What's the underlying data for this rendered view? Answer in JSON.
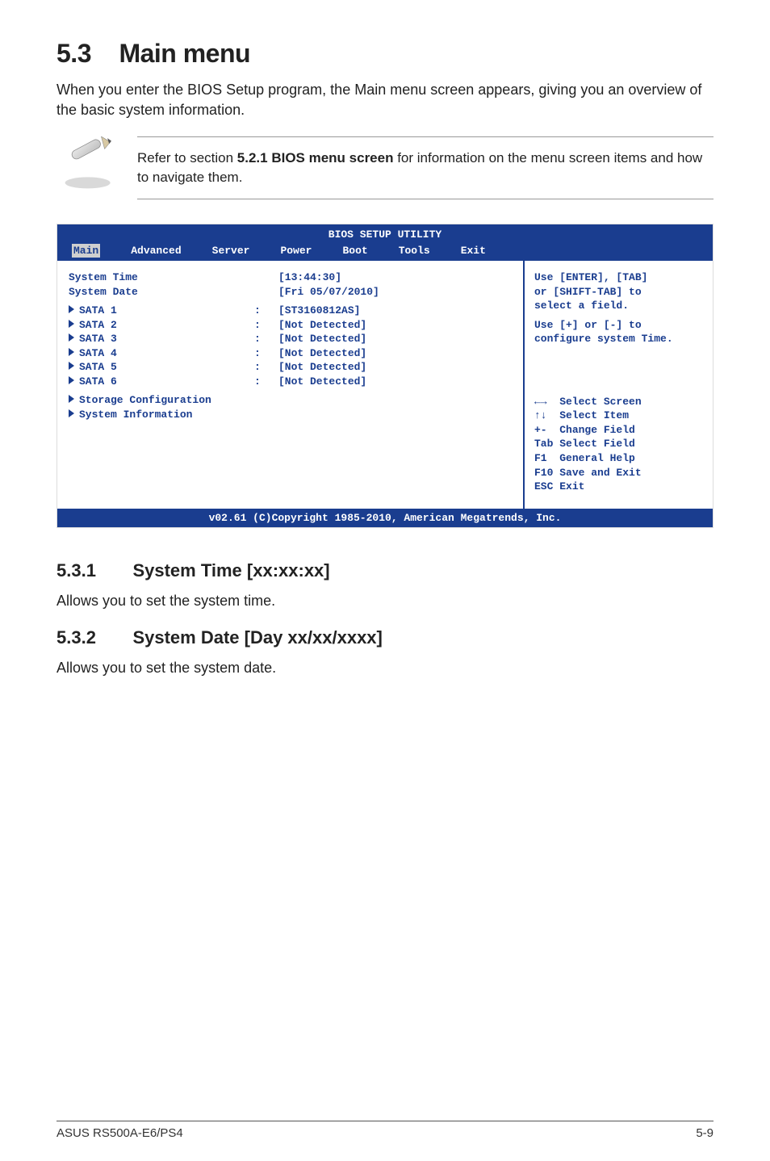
{
  "section": {
    "number": "5.3",
    "title": "Main menu",
    "intro": "When you enter the BIOS Setup program, the Main menu screen appears, giving you an overview of the basic system information."
  },
  "note": {
    "text_before": "Refer to section ",
    "bold": "5.2.1 BIOS menu screen",
    "text_after": " for information on the menu screen items and how to navigate them."
  },
  "bios": {
    "title": "BIOS SETUP UTILITY",
    "menu": [
      "Main",
      "Advanced",
      "Server",
      "Power",
      "Boot",
      "Tools",
      "Exit"
    ],
    "selected_menu": "Main",
    "left": {
      "system_time_label": "System Time",
      "system_time_value": "[13:44:30]",
      "system_date_label": "System Date",
      "system_date_value": "[Fri 05/07/2010]",
      "sata": [
        {
          "label": "SATA 1",
          "value": "[ST3160812AS]"
        },
        {
          "label": "SATA 2",
          "value": "[Not Detected]"
        },
        {
          "label": "SATA 3",
          "value": "[Not Detected]"
        },
        {
          "label": "SATA 4",
          "value": "[Not Detected]"
        },
        {
          "label": "SATA 5",
          "value": "[Not Detected]"
        },
        {
          "label": "SATA 6",
          "value": "[Not Detected]"
        }
      ],
      "storage_config": "Storage Configuration",
      "system_info": "System Information"
    },
    "right": {
      "help1": "Use [ENTER], [TAB]",
      "help2": "or [SHIFT-TAB] to",
      "help3": "select a field.",
      "help4": "Use [+] or [-] to",
      "help5": "configure system Time.",
      "keys": [
        {
          "k": "←→ ",
          "t": " Select Screen"
        },
        {
          "k": "↑↓ ",
          "t": " Select Item"
        },
        {
          "k": "+-  ",
          "t": "Change Field"
        },
        {
          "k": "Tab ",
          "t": "Select Field"
        },
        {
          "k": "F1  ",
          "t": "General Help"
        },
        {
          "k": "F10 ",
          "t": "Save and Exit"
        },
        {
          "k": "ESC ",
          "t": "Exit"
        }
      ]
    },
    "footer": "v02.61 (C)Copyright 1985-2010, American Megatrends, Inc."
  },
  "sub1": {
    "number": "5.3.1",
    "title": "System Time [xx:xx:xx]",
    "text": "Allows you to set the system time."
  },
  "sub2": {
    "number": "5.3.2",
    "title": "System Date [Day xx/xx/xxxx]",
    "text": "Allows you to set the system date."
  },
  "footer": {
    "product": "ASUS RS500A-E6/PS4",
    "page": "5-9"
  }
}
